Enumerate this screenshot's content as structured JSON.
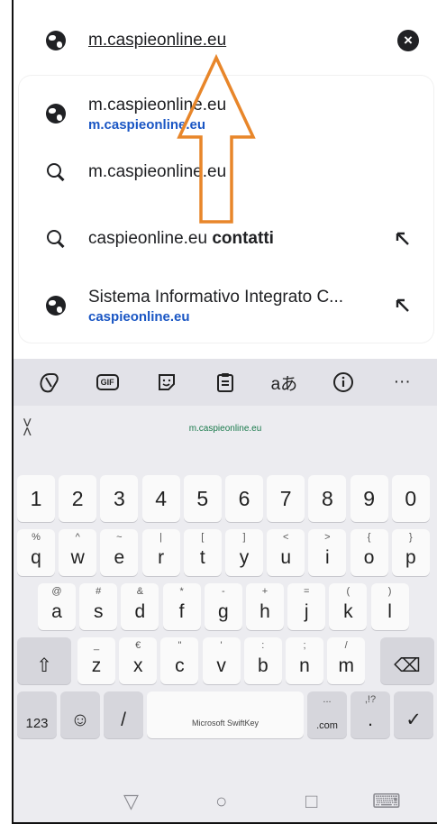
{
  "omnibox": {
    "url": "m.caspieonline.eu"
  },
  "suggestions": [
    {
      "title": "m.caspieonline.eu",
      "subtitle": "m.caspieonline.eu",
      "icon": "globe-icon"
    },
    {
      "title": "m.caspieonline.eu",
      "icon": "search-icon"
    },
    {
      "title_plain": "caspieonline.eu ",
      "title_bold": "contatti",
      "icon": "search-icon"
    },
    {
      "title": "Sistema Informativo Integrato C...",
      "subtitle": "caspieonline.eu",
      "icon": "globe-icon"
    }
  ],
  "keyboard": {
    "toolbar": [
      "copilot-icon",
      "GIF",
      "sticker-icon",
      "clipboard-icon",
      "aあ",
      "info-icon",
      "···"
    ],
    "prediction": "m.caspieonline.eu",
    "num_row": [
      "1",
      "2",
      "3",
      "4",
      "5",
      "6",
      "7",
      "8",
      "9",
      "0"
    ],
    "row1": [
      {
        "k": "q",
        "a": "%"
      },
      {
        "k": "w",
        "a": "^"
      },
      {
        "k": "e",
        "a": "~"
      },
      {
        "k": "r",
        "a": "|"
      },
      {
        "k": "t",
        "a": "["
      },
      {
        "k": "y",
        "a": "]"
      },
      {
        "k": "u",
        "a": "<"
      },
      {
        "k": "i",
        "a": ">"
      },
      {
        "k": "o",
        "a": "{"
      },
      {
        "k": "p",
        "a": "}"
      }
    ],
    "row2": [
      {
        "k": "a",
        "a": "@"
      },
      {
        "k": "s",
        "a": "#"
      },
      {
        "k": "d",
        "a": "&"
      },
      {
        "k": "f",
        "a": "*"
      },
      {
        "k": "g",
        "a": "-"
      },
      {
        "k": "h",
        "a": "+"
      },
      {
        "k": "j",
        "a": "="
      },
      {
        "k": "k",
        "a": "("
      },
      {
        "k": "l",
        "a": ")"
      }
    ],
    "row3": [
      {
        "k": "z",
        "a": "_"
      },
      {
        "k": "x",
        "a": "€"
      },
      {
        "k": "c",
        "a": "\""
      },
      {
        "k": "v",
        "a": "'"
      },
      {
        "k": "b",
        "a": ":"
      },
      {
        "k": "n",
        "a": ";"
      },
      {
        "k": "m",
        "a": "/"
      }
    ],
    "shift": "⇧",
    "backspace": "⌫",
    "num_key": "123",
    "emoji": "☺",
    "slash": "/",
    "space": "Microsoft SwiftKey",
    "com": ".com",
    "com_alt": "...",
    "dot": ".",
    "dot_alt": ",!?",
    "enter": "✓"
  },
  "nav": {
    "back": "▽",
    "home": "○",
    "recents": "□",
    "keyboard": "⌨"
  },
  "colors": {
    "link": "#1a56c4",
    "arrow": "#e8862a"
  }
}
